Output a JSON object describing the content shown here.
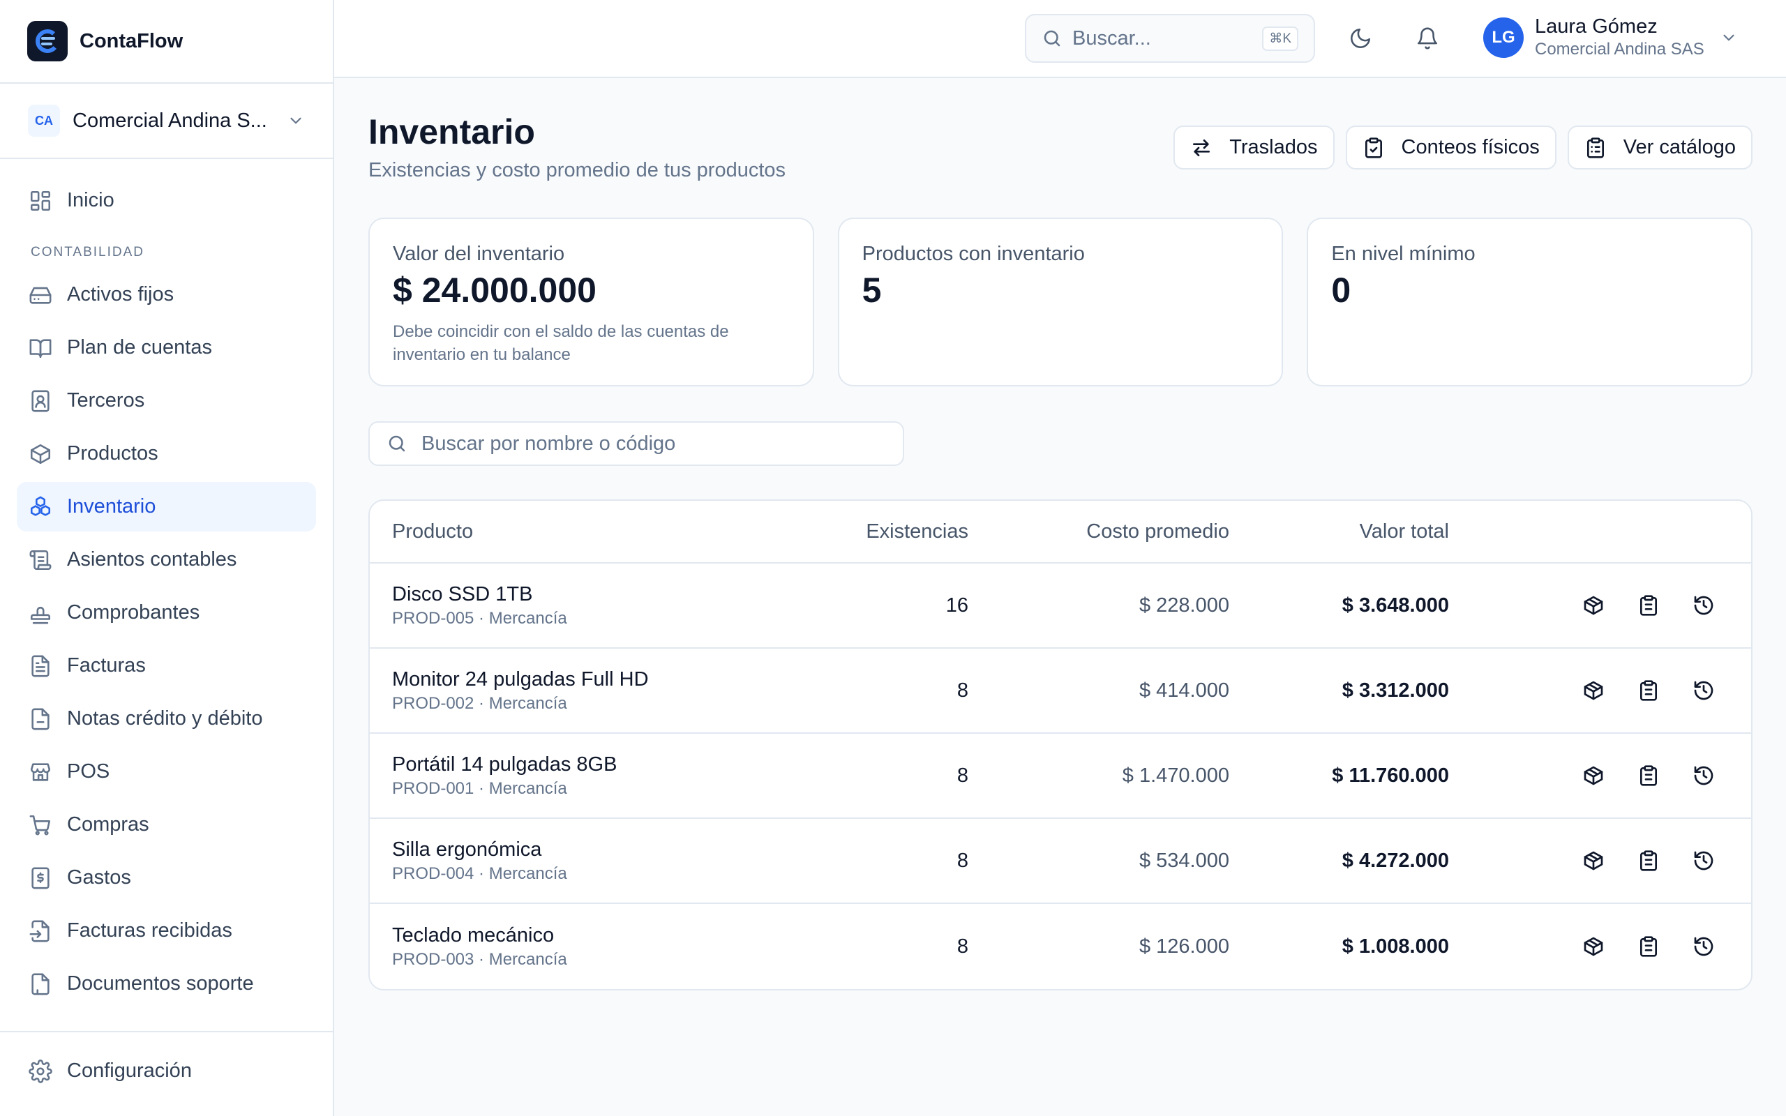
{
  "app": {
    "name": "ContaFlow"
  },
  "company": {
    "badge": "CA",
    "name": "Comercial Andina S..."
  },
  "sidebar": {
    "top_items": [
      {
        "label": "Inicio",
        "icon": "dashboard-icon"
      }
    ],
    "section_title": "CONTABILIDAD",
    "items": [
      {
        "label": "Activos fijos",
        "icon": "hard-drive-icon"
      },
      {
        "label": "Plan de cuentas",
        "icon": "book-icon"
      },
      {
        "label": "Terceros",
        "icon": "contact-icon"
      },
      {
        "label": "Productos",
        "icon": "package-icon"
      },
      {
        "label": "Inventario",
        "icon": "boxes-icon",
        "active": true
      },
      {
        "label": "Asientos contables",
        "icon": "scroll-icon"
      },
      {
        "label": "Comprobantes",
        "icon": "stamp-icon"
      },
      {
        "label": "Facturas",
        "icon": "file-text-icon"
      },
      {
        "label": "Notas crédito y débito",
        "icon": "file-icon"
      },
      {
        "label": "POS",
        "icon": "store-icon"
      },
      {
        "label": "Compras",
        "icon": "cart-icon"
      },
      {
        "label": "Gastos",
        "icon": "receipt-icon"
      },
      {
        "label": "Facturas recibidas",
        "icon": "file-input-icon"
      },
      {
        "label": "Documentos soporte",
        "icon": "file-copy-icon"
      }
    ],
    "bottom_item": {
      "label": "Configuración",
      "icon": "gear-icon"
    }
  },
  "topbar": {
    "search_placeholder": "Buscar...",
    "shortcut": "⌘K",
    "user": {
      "initials": "LG",
      "name": "Laura Gómez",
      "company": "Comercial Andina SAS"
    }
  },
  "page": {
    "title": "Inventario",
    "subtitle": "Existencias y costo promedio de tus productos",
    "actions": [
      "Traslados",
      "Conteos físicos",
      "Ver catálogo"
    ]
  },
  "cards": [
    {
      "label": "Valor del inventario",
      "value": "$ 24.000.000",
      "note": "Debe coincidir con el saldo de las cuentas de inventario en tu balance"
    },
    {
      "label": "Productos con inventario",
      "value": "5"
    },
    {
      "label": "En nivel mínimo",
      "value": "0"
    }
  ],
  "filter": {
    "placeholder": "Buscar por nombre o código"
  },
  "table": {
    "headers": {
      "product": "Producto",
      "stock": "Existencias",
      "cost": "Costo promedio",
      "total": "Valor total"
    },
    "rows": [
      {
        "name": "Disco SSD 1TB",
        "meta": "PROD-005 · Mercancía",
        "stock": "16",
        "cost": "$ 228.000",
        "total": "$ 3.648.000"
      },
      {
        "name": "Monitor 24 pulgadas Full HD",
        "meta": "PROD-002 · Mercancía",
        "stock": "8",
        "cost": "$ 414.000",
        "total": "$ 3.312.000"
      },
      {
        "name": "Portátil 14 pulgadas 8GB",
        "meta": "PROD-001 · Mercancía",
        "stock": "8",
        "cost": "$ 1.470.000",
        "total": "$ 11.760.000"
      },
      {
        "name": "Silla ergonómica",
        "meta": "PROD-004 · Mercancía",
        "stock": "8",
        "cost": "$ 534.000",
        "total": "$ 4.272.000"
      },
      {
        "name": "Teclado mecánico",
        "meta": "PROD-003 · Mercancía",
        "stock": "8",
        "cost": "$ 126.000",
        "total": "$ 1.008.000"
      }
    ]
  },
  "colors": {
    "accent": "#2563eb",
    "active_bg": "#eff6ff",
    "border": "#e2e8f0",
    "muted": "#64748b"
  }
}
